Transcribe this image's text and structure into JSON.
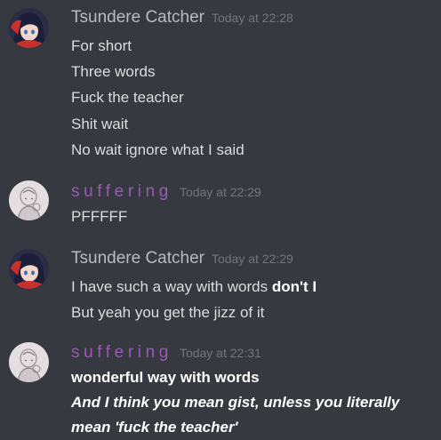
{
  "messages": [
    {
      "username": "Tsundere Catcher",
      "timestamp": "Today at 22:28",
      "lines": [
        "For short",
        "Three words",
        "Fuck the teacher",
        "Shit wait",
        "No wait ignore what I said"
      ]
    },
    {
      "username": "suffering",
      "timestamp": "Today at 22:29",
      "lines": [
        "PFFFFF"
      ]
    },
    {
      "username": "Tsundere Catcher",
      "timestamp": "Today at 22:29",
      "line1_plain": "I have such a way with words ",
      "line1_bold": "don't I",
      "line2": "But yeah you get the jizz of it"
    },
    {
      "username": "suffering",
      "timestamp": "Today at 22:31",
      "line1_bold": "wonderful way with words",
      "italic_line1": "And I think you mean gist, unless you literally",
      "italic_line2": "mean 'fuck the teacher'"
    }
  ],
  "colors": {
    "background": "#36393f",
    "username_tsundere": "#b9bbbe",
    "username_suffering": "#9b59b6",
    "timestamp": "#72767d",
    "text": "#dcddde"
  }
}
